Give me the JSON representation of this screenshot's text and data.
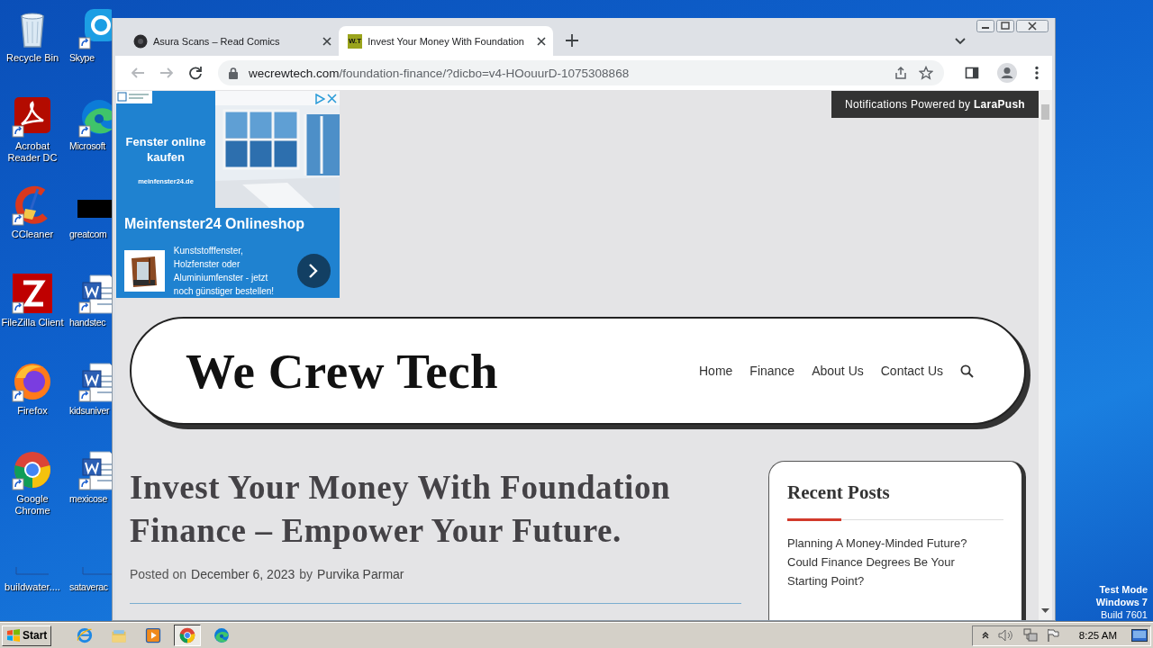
{
  "desktop": {
    "icons": [
      {
        "label": "Recycle Bin",
        "kind": "recycle-bin",
        "shortcut": false
      },
      {
        "label": "Skype",
        "kind": "skype",
        "shortcut": true
      },
      {
        "label": "Acrobat Reader DC",
        "kind": "acrobat",
        "shortcut": true
      },
      {
        "label": "Microsoft",
        "kind": "edge",
        "shortcut": true
      },
      {
        "label": "CCleaner",
        "kind": "ccleaner",
        "shortcut": true
      },
      {
        "label": "greatcom",
        "kind": "black-bar",
        "shortcut": false
      },
      {
        "label": "FileZilla Client",
        "kind": "filezilla",
        "shortcut": true
      },
      {
        "label": "handstec",
        "kind": "word",
        "shortcut": true
      },
      {
        "label": "Firefox",
        "kind": "firefox",
        "shortcut": true
      },
      {
        "label": "kidsuniver",
        "kind": "word",
        "shortcut": true
      },
      {
        "label": "Google Chrome",
        "kind": "chrome",
        "shortcut": true
      },
      {
        "label": "mexicose",
        "kind": "word",
        "shortcut": true
      },
      {
        "label": "buildwater....",
        "kind": "blank",
        "shortcut": false
      },
      {
        "label": "sataverac",
        "kind": "blank",
        "shortcut": false
      }
    ],
    "system_notice": [
      "Test Mode",
      "Windows 7",
      "Build 7601"
    ]
  },
  "browser": {
    "tabs": [
      {
        "title": "Asura Scans – Read Comics",
        "kind": "circle",
        "selected": false
      },
      {
        "title": "Invest Your Money With Foundation",
        "kind": "logo",
        "favicon_text": "W.T",
        "selected": true
      }
    ],
    "nav_buttons": [
      {
        "kind": "back",
        "disabled": true
      },
      {
        "kind": "forward",
        "disabled": true
      },
      {
        "kind": "reload",
        "disabled": false
      }
    ],
    "address": {
      "host": "wecrewtech.com",
      "path": "/foundation-finance/?dicbo=v4-HOouurD-1075308868"
    }
  },
  "page": {
    "ad": {
      "headline": "Fenster online kaufen",
      "url": "meinfenster24.de",
      "title": "Meinfenster24 Onlineshop",
      "text": "Kunststofffenster, Holzfenster oder Aluminiumfenster - jetzt noch günstiger bestellen!"
    },
    "notification": "Notifications Powered by **LaraPush**",
    "site": {
      "logo": "We Crew Tech",
      "nav": [
        "Home",
        "Finance",
        "About Us",
        "Contact Us"
      ]
    },
    "article": {
      "title": "Invest Your Money With Foundation Finance – Empower Your Future.",
      "meta": {
        "prefix": "Posted on",
        "date": "December 6, 2023",
        "by": "by",
        "author": "Purvika Parmar"
      }
    },
    "sidebar": {
      "title": "Recent Posts",
      "posts": [
        "Planning A Money-Minded Future? Could Finance Degrees Be Your Starting Point?"
      ]
    }
  },
  "taskbar": {
    "start": "Start",
    "apps": [
      {
        "kind": "ie",
        "selected": false
      },
      {
        "kind": "explorer",
        "selected": false
      },
      {
        "kind": "media",
        "selected": false
      },
      {
        "kind": "chrome",
        "selected": true
      },
      {
        "kind": "edge",
        "selected": false
      }
    ],
    "clock": "8:25 AM"
  }
}
